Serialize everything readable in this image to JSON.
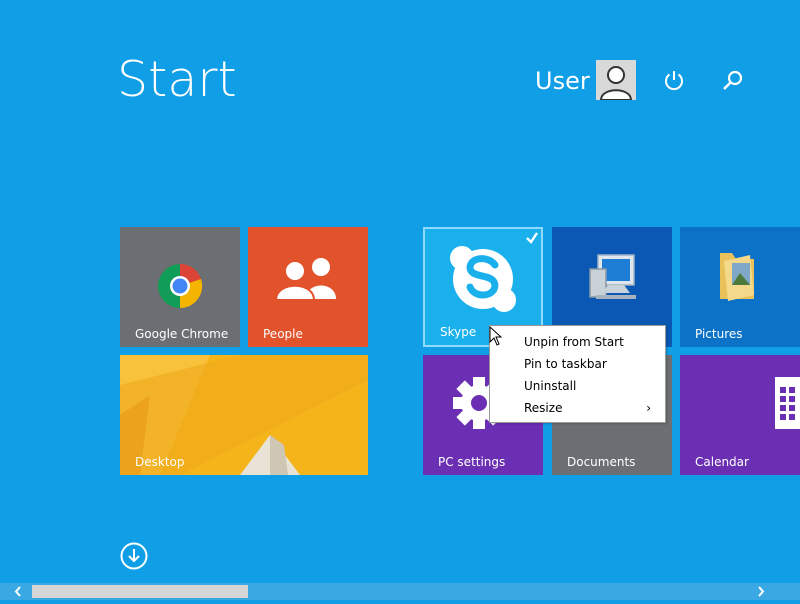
{
  "header": {
    "title": "Start",
    "user_name": "User"
  },
  "tiles": {
    "chrome": {
      "label": "Google Chrome"
    },
    "people": {
      "label": "People"
    },
    "desktop": {
      "label": "Desktop"
    },
    "skype": {
      "label": "Skype"
    },
    "pictures": {
      "label": "Pictures"
    },
    "pc_settings": {
      "label": "PC settings"
    },
    "documents": {
      "label": "Documents"
    },
    "calendar": {
      "label": "Calendar"
    }
  },
  "context_menu": {
    "items": [
      {
        "label": "Unpin from Start"
      },
      {
        "label": "Pin to taskbar"
      },
      {
        "label": "Uninstall"
      },
      {
        "label": "Resize"
      }
    ]
  },
  "icons": {
    "power": "power-icon",
    "search": "search-icon",
    "apps": "down-arrow-circle-icon",
    "skype": "skype-icon",
    "chrome": "chrome-icon",
    "people": "people-icon",
    "computer": "computer-icon",
    "pictures": "folder-icon",
    "settings": "gear-icon",
    "calendar": "calendar-icon"
  },
  "colors": {
    "background": "#109ee6",
    "chrome_tile": "#6b6f73",
    "people_tile": "#e2522b",
    "desktop_tile": "#f4b41a",
    "skype_tile": "#1ab0ec",
    "computer_tile": "#0a58b4",
    "pictures_tile": "#0b72c8",
    "settings_tile": "#6b2fb3",
    "calendar_tile": "#6b2fb3"
  }
}
